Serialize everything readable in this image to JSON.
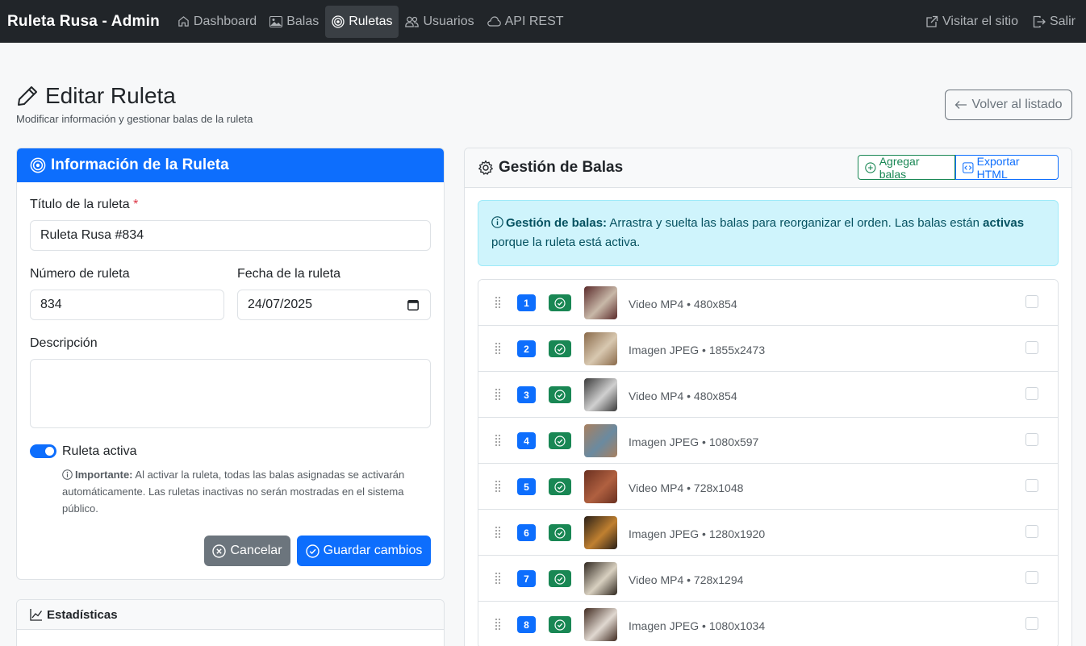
{
  "navbar": {
    "brand": "Ruleta Rusa - Admin",
    "items": [
      {
        "label": "Dashboard",
        "icon": "house-icon"
      },
      {
        "label": "Balas",
        "icon": "image-icon"
      },
      {
        "label": "Ruletas",
        "icon": "target-icon",
        "active": true
      },
      {
        "label": "Usuarios",
        "icon": "people-icon"
      },
      {
        "label": "API REST",
        "icon": "cloud-icon"
      }
    ],
    "right": [
      {
        "label": "Visitar el sitio",
        "icon": "external-link-icon"
      },
      {
        "label": "Salir",
        "icon": "logout-icon"
      }
    ]
  },
  "header": {
    "title": "Editar Ruleta",
    "subtitle": "Modificar información y gestionar balas de la ruleta",
    "back_label": "Volver al listado"
  },
  "info_card": {
    "title": "Información de la Ruleta",
    "title_label": "Título de la ruleta",
    "required_mark": "*",
    "title_value": "Ruleta Rusa #834",
    "number_label": "Número de ruleta",
    "number_value": "834",
    "date_label": "Fecha de la ruleta",
    "date_value": "24/07/2025",
    "description_label": "Descripción",
    "description_value": "",
    "active_label": "Ruleta activa",
    "active": true,
    "note_strong": "Importante:",
    "note_text": "Al activar la ruleta, todas las balas asignadas se activarán automáticamente. Las ruletas inactivas no serán mostradas en el sistema público.",
    "cancel_label": "Cancelar",
    "save_label": "Guardar cambios"
  },
  "stats_card": {
    "title": "Estadísticas"
  },
  "bullets_card": {
    "title": "Gestión de Balas",
    "add_label": "Agregar balas",
    "export_label": "Exportar HTML",
    "alert_strong": "Gestión de balas:",
    "alert_text_1": "Arrastra y suelta las balas para reorganizar el orden. Las balas están",
    "alert_strong_2": "activas",
    "alert_text_2": "porque la ruleta está activa.",
    "bullets": [
      {
        "num": "1",
        "desc": "Video MP4 • 480x854",
        "thumb_colors": [
          "#5a2a2a",
          "#c8b8a8"
        ]
      },
      {
        "num": "2",
        "desc": "Imagen JPEG • 1855x2473",
        "thumb_colors": [
          "#8a6a4a",
          "#d8c8b0"
        ]
      },
      {
        "num": "3",
        "desc": "Video MP4 • 480x854",
        "thumb_colors": [
          "#3a3a3a",
          "#d0d0d0"
        ]
      },
      {
        "num": "4",
        "desc": "Imagen JPEG • 1080x597",
        "thumb_colors": [
          "#a88060",
          "#6a8aa0"
        ]
      },
      {
        "num": "5",
        "desc": "Video MP4 • 728x1048",
        "thumb_colors": [
          "#6a3020",
          "#b06040"
        ]
      },
      {
        "num": "6",
        "desc": "Imagen JPEG • 1280x1920",
        "thumb_colors": [
          "#2a2018",
          "#c08030"
        ]
      },
      {
        "num": "7",
        "desc": "Video MP4 • 728x1294",
        "thumb_colors": [
          "#302820",
          "#d8d0c0"
        ]
      },
      {
        "num": "8",
        "desc": "Imagen JPEG • 1080x1034",
        "thumb_colors": [
          "#402a20",
          "#e0d8d0"
        ]
      }
    ]
  }
}
